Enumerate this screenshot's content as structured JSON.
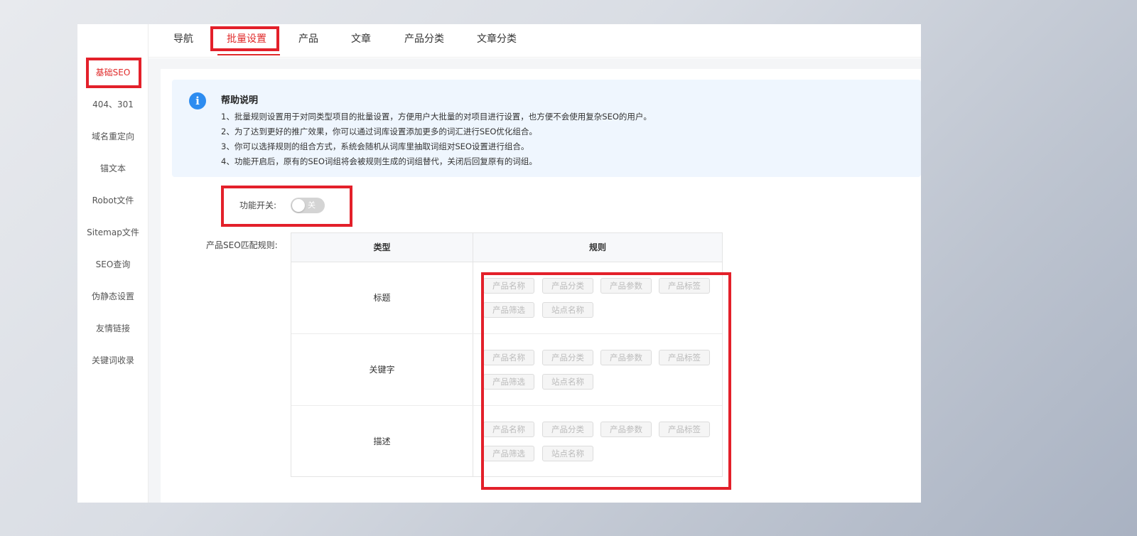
{
  "tabs": [
    "导航",
    "批量设置",
    "产品",
    "文章",
    "产品分类",
    "文章分类"
  ],
  "active_tab": "批量设置",
  "sidebar": {
    "items": [
      "基础SEO",
      "404、301",
      "域名重定向",
      "锚文本",
      "Robot文件",
      "Sitemap文件",
      "SEO查询",
      "伪静态设置",
      "友情链接",
      "关键词收录"
    ],
    "active": "基础SEO"
  },
  "help": {
    "title": "帮助说明",
    "lines": [
      "1、批量规则设置用于对同类型项目的批量设置，方便用户大批量的对项目进行设置，也方便不会使用复杂SEO的用户。",
      "2、为了达到更好的推广效果，你可以通过词库设置添加更多的词汇进行SEO优化组合。",
      "3、你可以选择规则的组合方式，系统会随机从词库里抽取词组对SEO设置进行组合。",
      "4、功能开启后，原有的SEO词组将会被规则生成的词组替代，关闭后回复原有的词组。"
    ]
  },
  "function_switch": {
    "label": "功能开关:",
    "state_text": "关",
    "on": false
  },
  "rules": {
    "label": "产品SEO匹配规则:",
    "headers": [
      "类型",
      "规则"
    ],
    "rows": [
      {
        "type": "标题",
        "tags": [
          "产品名称",
          "产品分类",
          "产品参数",
          "产品标签",
          "产品筛选",
          "站点名称"
        ]
      },
      {
        "type": "关键字",
        "tags": [
          "产品名称",
          "产品分类",
          "产品参数",
          "产品标签",
          "产品筛选",
          "站点名称"
        ]
      },
      {
        "type": "描述",
        "tags": [
          "产品名称",
          "产品分类",
          "产品参数",
          "产品标签",
          "产品筛选",
          "站点名称"
        ]
      }
    ]
  },
  "colors": {
    "accent": "#e02a2a",
    "highlight": "#e3202a",
    "info": "#2d8cf0",
    "help_bg": "#eff6fe"
  }
}
